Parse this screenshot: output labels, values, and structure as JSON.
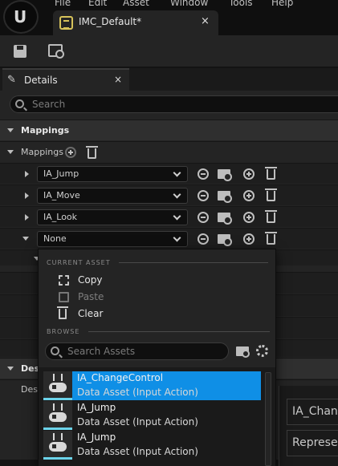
{
  "menubar": {
    "items": [
      "File",
      "Edit",
      "Asset",
      "Window",
      "Tools",
      "Help"
    ]
  },
  "document_tab": {
    "label": "IMC_Default*",
    "close": "×"
  },
  "details": {
    "title": "Details",
    "close": "×",
    "search_placeholder": "Search"
  },
  "sections": {
    "mappings_category": "Mappings",
    "mappings_property": "Mappings",
    "description_category": "Desc",
    "description_row": "Desc"
  },
  "mappings": [
    {
      "action": "IA_Jump"
    },
    {
      "action": "IA_Move"
    },
    {
      "action": "IA_Look"
    },
    {
      "action": "None"
    }
  ],
  "picker": {
    "current_asset_heading": "CURRENT ASSET",
    "copy": "Copy",
    "paste": "Paste",
    "clear": "Clear",
    "browse_heading": "BROWSE",
    "search_placeholder": "Search Assets",
    "assets": [
      {
        "name": "IA_ChangeControl",
        "type": "Data Asset (Input Action)",
        "selected": true
      },
      {
        "name": "IA_Jump",
        "type": "Data Asset (Input Action)",
        "selected": false
      },
      {
        "name": "IA_Jump",
        "type": "Data Asset (Input Action)",
        "selected": false
      }
    ]
  },
  "right_panel": {
    "field1": "IA_Chan",
    "field2": "Represe"
  },
  "colors": {
    "accent": "#0f8fe6",
    "thumb_underline": "#6bd3ea",
    "tab_icon": "#d6c25a"
  }
}
